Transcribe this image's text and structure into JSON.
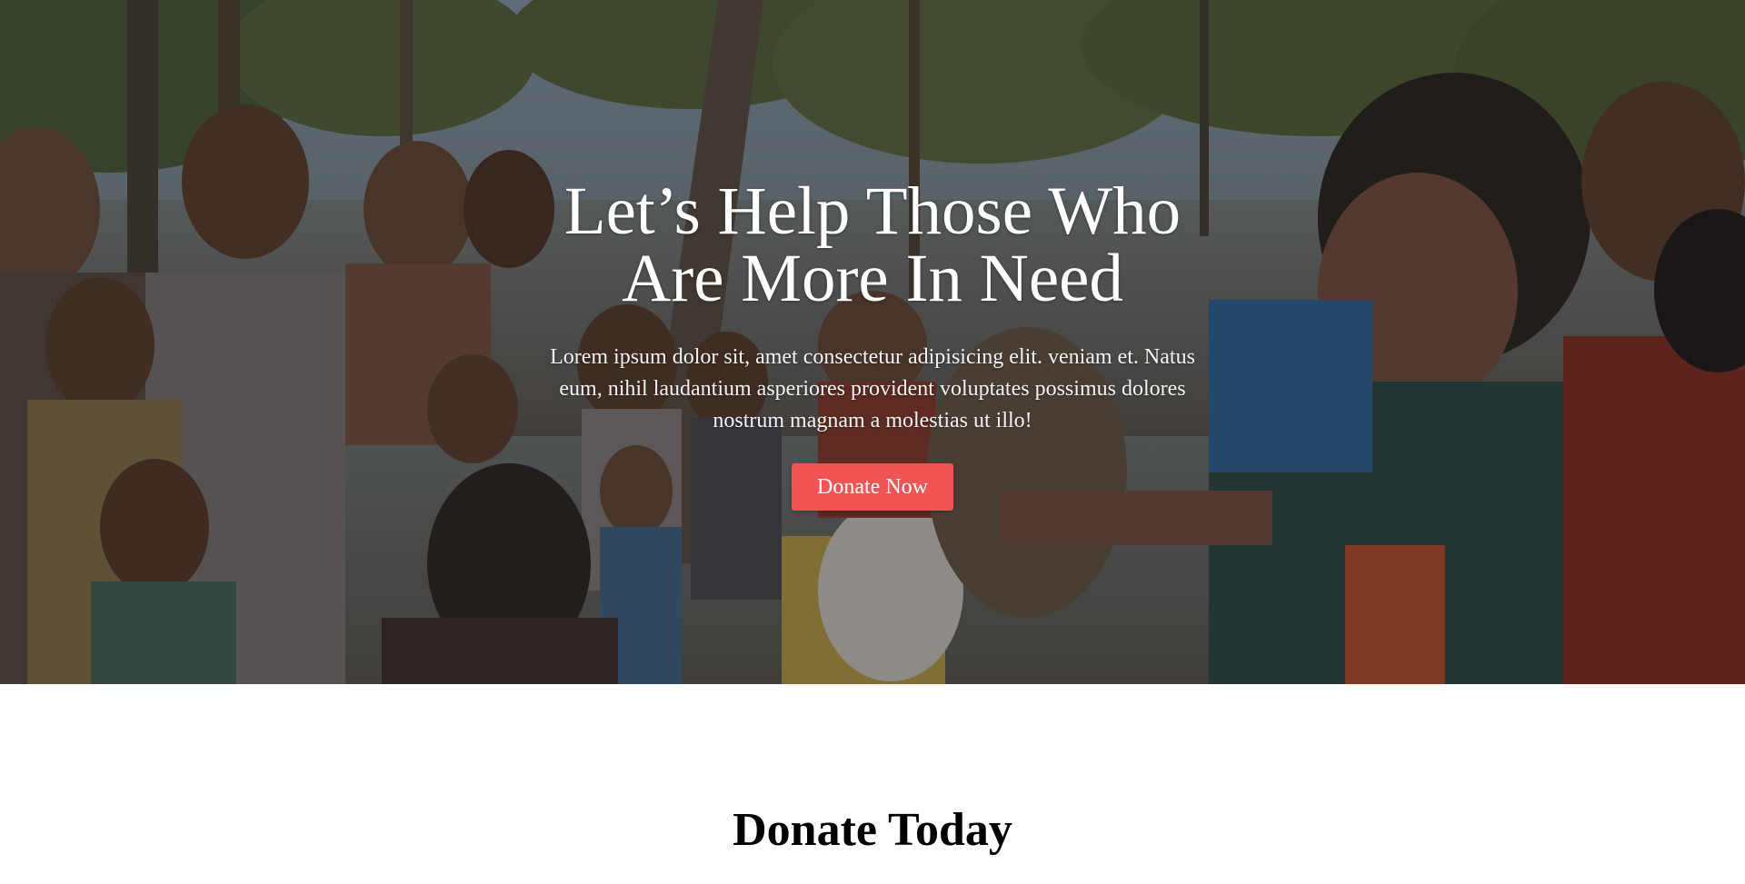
{
  "hero": {
    "title_line1": "Let’s Help Those Who",
    "title_line2": "Are More In Need",
    "description": "Lorem ipsum dolor sit, amet consectetur adipisicing elit. veniam et. Natus eum, nihil laudantium asperiores provident voluptates possimus dolores nostrum magnam a molestias ut illo!",
    "donate_button_label": "Donate Now"
  },
  "section": {
    "title": "Donate Today"
  },
  "colors": {
    "accent": "#f05454",
    "text_light": "#ffffff",
    "heading_dark": "#000000"
  }
}
